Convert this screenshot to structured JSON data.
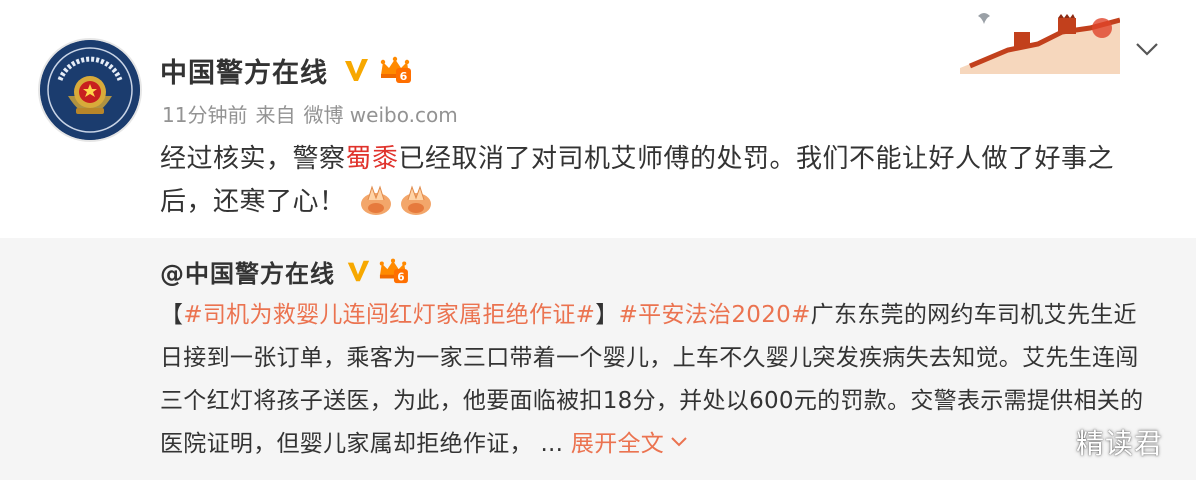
{
  "header": {
    "username": "中国警方在线",
    "meta": {
      "time": "11分钟前",
      "from_label": "来自",
      "source": "微博 weibo.com"
    }
  },
  "post": {
    "text_before": "经过核实，警察",
    "highlight": "蜀黍",
    "text_after": "已经取消了对司机艾师傅的处罚。我们不能让好人做了好事之后，还寒了心！",
    "emoji": [
      "pray-emoji",
      "pray-emoji"
    ]
  },
  "repost": {
    "username": "@中国警方在线",
    "bracket_open": "【",
    "tag1": "#司机为救婴儿连闯红灯家属拒绝作证#",
    "bracket_close": "】",
    "tag2": "#平安法治2020#",
    "body": "广东东莞的网约车司机艾先生近日接到一张订单，乘客为一家三口带着一个婴儿，上车不久婴儿突发疾病失去知觉。艾先生连闯三个红灯将孩子送医，为此，他要面临被扣18分，并处以600元的罚款。交警表示需提供相关的医院证明，但婴儿家属却拒绝作证，",
    "ellipsis": "...",
    "expand_label": "展开全文"
  },
  "watermark": "精读君",
  "icons": {
    "verified": "verified-v-icon",
    "vip": "vip-crown-badge-icon",
    "more": "chevron-down-icon",
    "decoration": "great-wall-decoration"
  },
  "colors": {
    "highlight": "#e0322b",
    "tag": "#eb7350",
    "verified": "#f7a800",
    "repost_bg": "#f5f5f5"
  }
}
